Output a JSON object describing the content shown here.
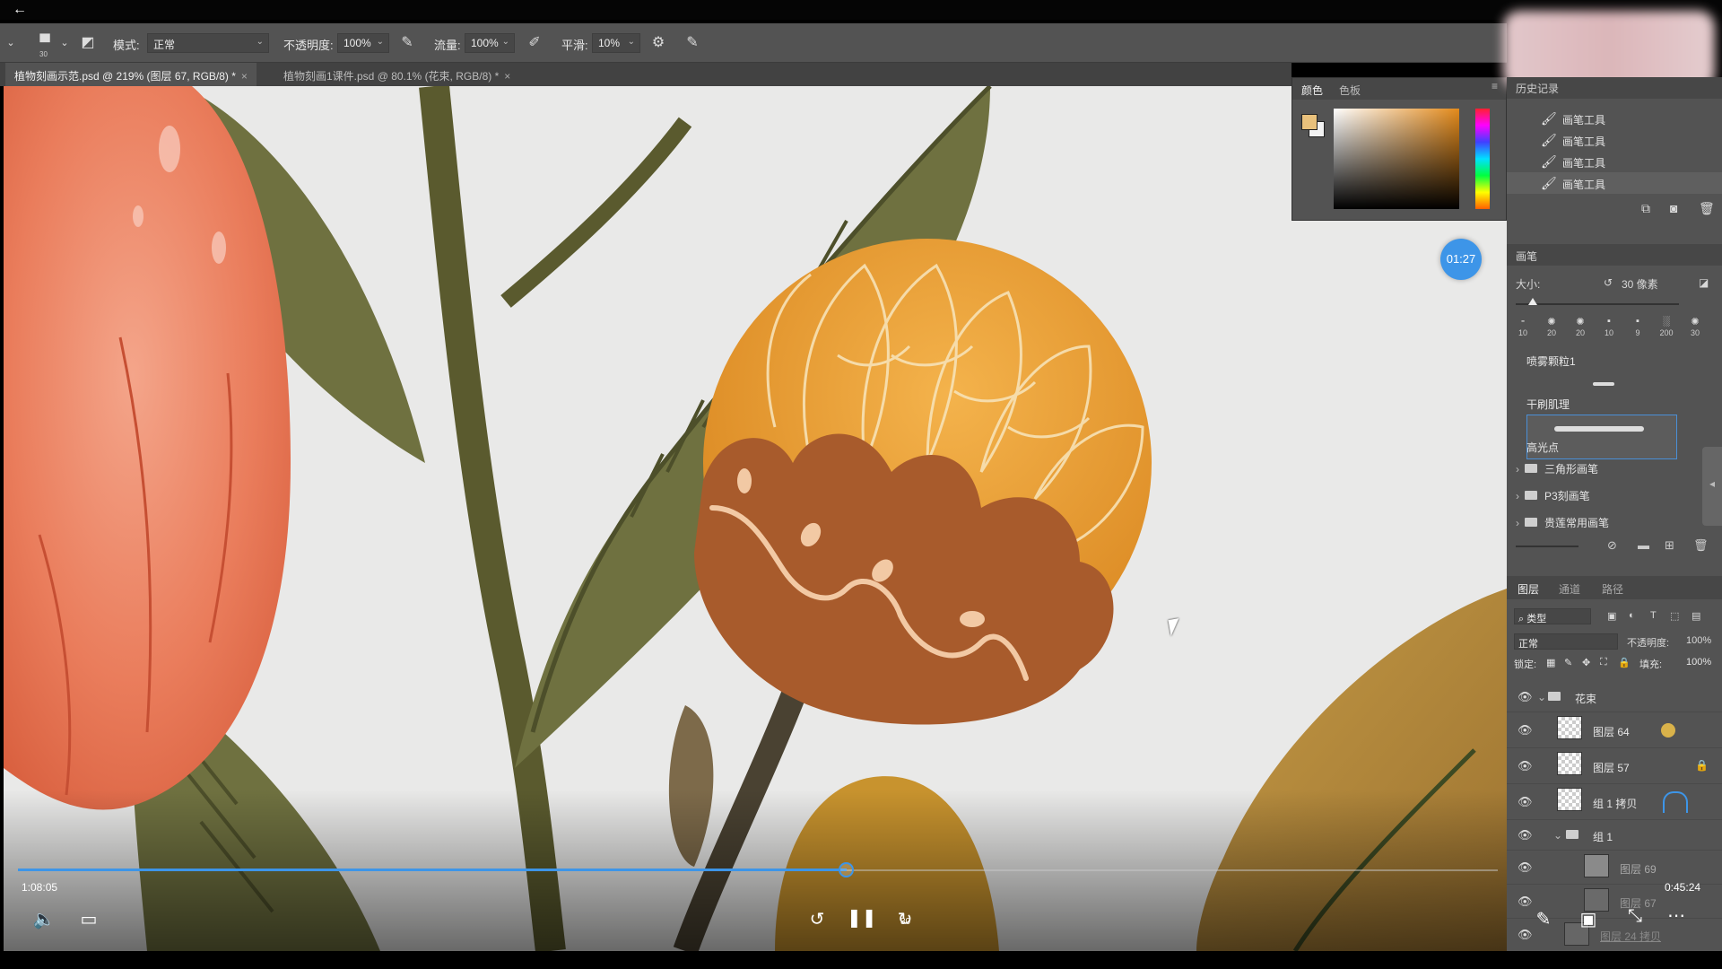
{
  "nav": {
    "back_icon": "back-arrow-icon"
  },
  "options": {
    "mode_label": "模式:",
    "mode_value": "正常",
    "opacity_label": "不透明度:",
    "opacity_value": "100%",
    "flow_label": "流量:",
    "flow_value": "100%",
    "smooth_label": "平滑:",
    "smooth_value": "10%",
    "brush_size_badge": "30"
  },
  "documents": {
    "tabs": [
      {
        "label": "植物刻画示范.psd @ 219% (图层 67, RGB/8) *",
        "close": "×"
      },
      {
        "label": "植物刻画1课件.psd @ 80.1% (花束, RGB/8) *",
        "close": "×"
      }
    ]
  },
  "color_panel": {
    "tabs": [
      "颜色",
      "色板"
    ],
    "foreground": "#e9c17c",
    "background": "#f2f2f2"
  },
  "history": {
    "title": "历史记录",
    "items": [
      "画笔工具",
      "画笔工具",
      "画笔工具",
      "画笔工具"
    ]
  },
  "timer_badge": "01:27",
  "brush_panel": {
    "title": "画笔",
    "size_label": "大小:",
    "size_value": "30 像素",
    "presets": [
      "10",
      "20",
      "20",
      "10",
      "9",
      "200",
      "30"
    ],
    "brushes": [
      "喷雾颗粒1",
      "干刷肌理",
      "高光点"
    ],
    "folders": [
      "三角形画笔",
      "P3刻画笔",
      "贵莲常用画笔"
    ]
  },
  "layers_panel": {
    "tabs": [
      "图层",
      "通道",
      "路径"
    ],
    "filter_label": "类型",
    "blend_mode": "正常",
    "opacity_label": "不透明度:",
    "opacity_value": "100%",
    "lock_label": "锁定:",
    "fill_label": "填充:",
    "fill_value": "100%",
    "layers": [
      "花束",
      "图层 64",
      "图层 57",
      "组 1 拷贝",
      "组 1",
      "图层 69",
      "图层 67",
      "图层 24 拷贝"
    ]
  },
  "player": {
    "elapsed": "1:08:05",
    "remaining": "0:45:24",
    "progress": 0.56,
    "skip_forward_label": "30"
  }
}
